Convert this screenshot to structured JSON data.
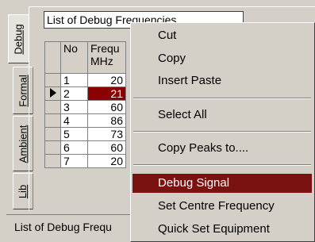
{
  "tabs": [
    {
      "label": "Debug",
      "active": true
    },
    {
      "label": "Formal",
      "active": false
    },
    {
      "label": "Ambient",
      "active": false
    },
    {
      "label": "Lib",
      "active": false
    }
  ],
  "grid": {
    "title": "List of Debug Frequencies",
    "columns": {
      "no": "No",
      "freq": "Frequ\nMHz"
    },
    "rows": [
      {
        "no": "1",
        "freq": "20"
      },
      {
        "no": "2",
        "freq": "21",
        "selected": true
      },
      {
        "no": "3",
        "freq": "60"
      },
      {
        "no": "4",
        "freq": "86"
      },
      {
        "no": "5",
        "freq": "73"
      },
      {
        "no": "6",
        "freq": "60"
      },
      {
        "no": "7",
        "freq": "20"
      }
    ]
  },
  "status": {
    "text": "List of Debug Frequ"
  },
  "context_menu": {
    "items": [
      "Cut",
      "Copy",
      "Insert Paste",
      "Select All",
      "Copy Peaks to....",
      "Debug Signal",
      "Set Centre Frequency",
      "Quick Set Equipment"
    ],
    "highlighted": "Debug Signal"
  },
  "colors": {
    "highlight": "#7a1212",
    "selected_cell": "#8b0000",
    "face": "#d4d0c8"
  }
}
